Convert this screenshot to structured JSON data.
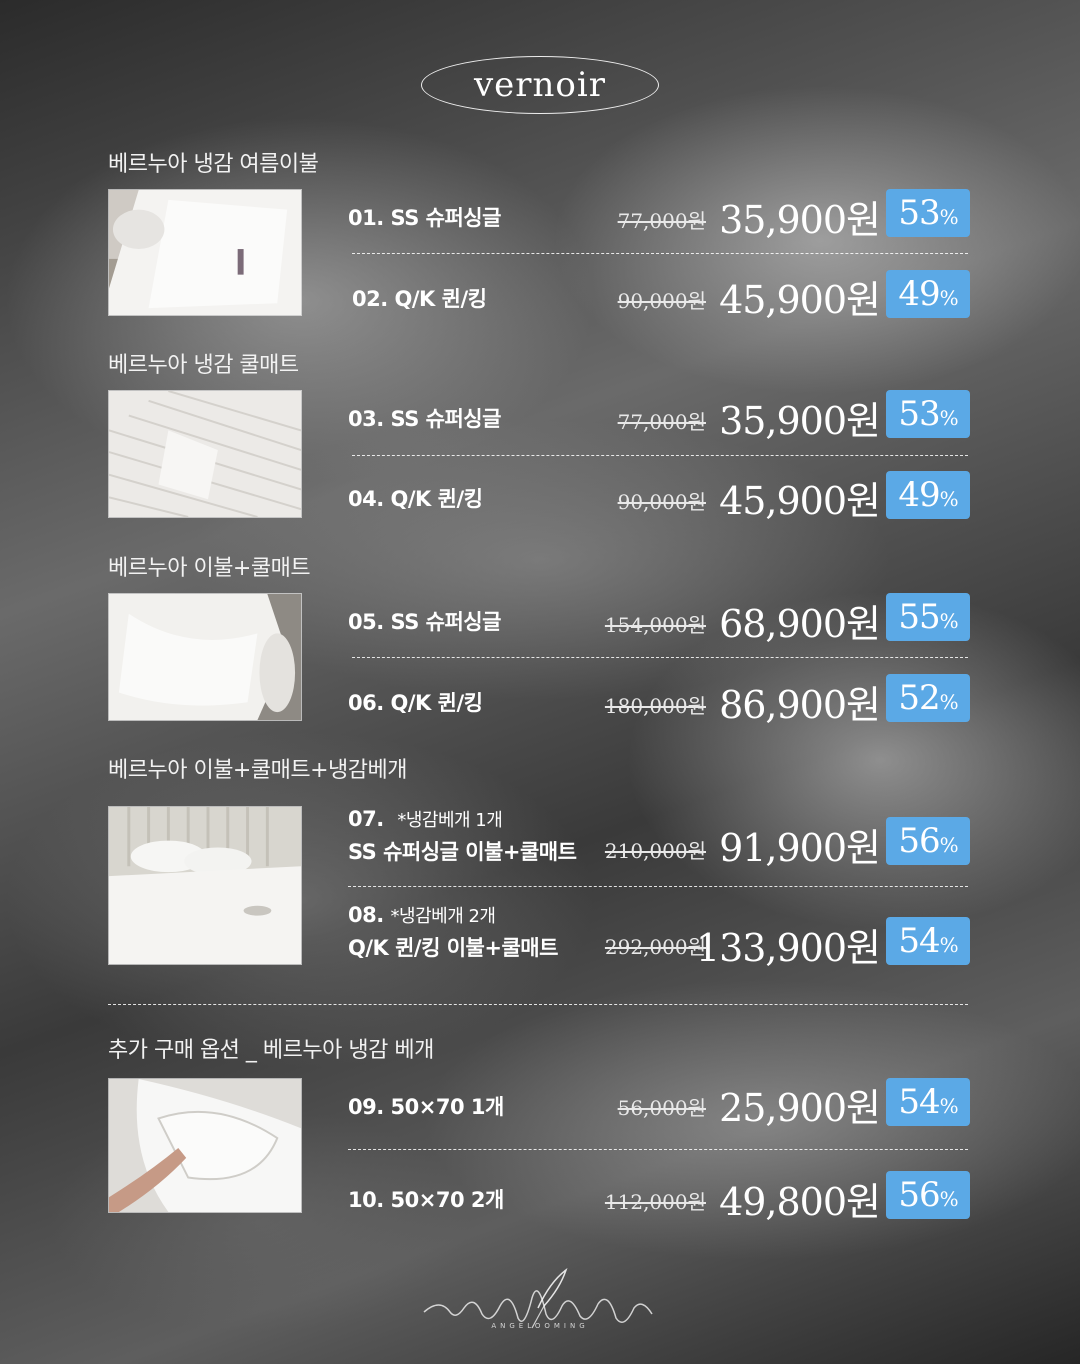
{
  "brand": "vernoir",
  "signature": {
    "tag": "ANGELOOMING"
  },
  "colors": {
    "badge": "#5ba9e6",
    "text": "#ffffff"
  },
  "sections": [
    {
      "title": "베르누아 냉감 여름이불"
    },
    {
      "title": "베르누아 냉감 쿨매트"
    },
    {
      "title": "베르누아 이불+쿨매트"
    },
    {
      "title": "베르누아 이불+쿨매트+냉감베개"
    },
    {
      "title": "추가 구매 옵션 _ 베르누아 냉감 베개"
    }
  ],
  "items": [
    {
      "name": "01. SS 슈퍼싱글",
      "original_price": "77,000원",
      "price": "35,900원",
      "discount": "53",
      "pct": "%"
    },
    {
      "name": "02. Q/K 퀸/킹",
      "original_price": "90,000원",
      "price": "45,900원",
      "discount": "49",
      "pct": "%"
    },
    {
      "name": "03. SS 슈퍼싱글",
      "original_price": "77,000원",
      "price": "35,900원",
      "discount": "53",
      "pct": "%"
    },
    {
      "name": "04. Q/K 퀸/킹",
      "original_price": "90,000원",
      "price": "45,900원",
      "discount": "49",
      "pct": "%"
    },
    {
      "name": "05. SS 슈퍼싱글",
      "original_price": "154,000원",
      "price": "68,900원",
      "discount": "55",
      "pct": "%"
    },
    {
      "name": "06. Q/K 퀸/킹",
      "original_price": "180,000원",
      "price": "86,900원",
      "discount": "52",
      "pct": "%"
    },
    {
      "name": "07.",
      "note": "*냉감베개 1개",
      "sub": "SS 슈퍼싱글 이불+쿨매트",
      "original_price": "210,000원",
      "price": "91,900원",
      "discount": "56",
      "pct": "%"
    },
    {
      "name": "08.",
      "note": "*냉감베개 2개",
      "sub": "Q/K 퀸/킹 이불+쿨매트",
      "original_price": "292,000원",
      "price": "133,900원",
      "discount": "54",
      "pct": "%"
    },
    {
      "name": "09. 50×70 1개",
      "original_price": "56,000원",
      "price": "25,900원",
      "discount": "54",
      "pct": "%"
    },
    {
      "name": "10. 50×70 2개",
      "original_price": "112,000원",
      "price": "49,800원",
      "discount": "56",
      "pct": "%"
    }
  ],
  "photos": [
    {
      "icon": "blanket-photo-icon"
    },
    {
      "icon": "cool-mat-photo-icon"
    },
    {
      "icon": "bedding-set-photo-icon"
    },
    {
      "icon": "bedroom-photo-icon"
    },
    {
      "icon": "pillow-photo-icon"
    }
  ]
}
